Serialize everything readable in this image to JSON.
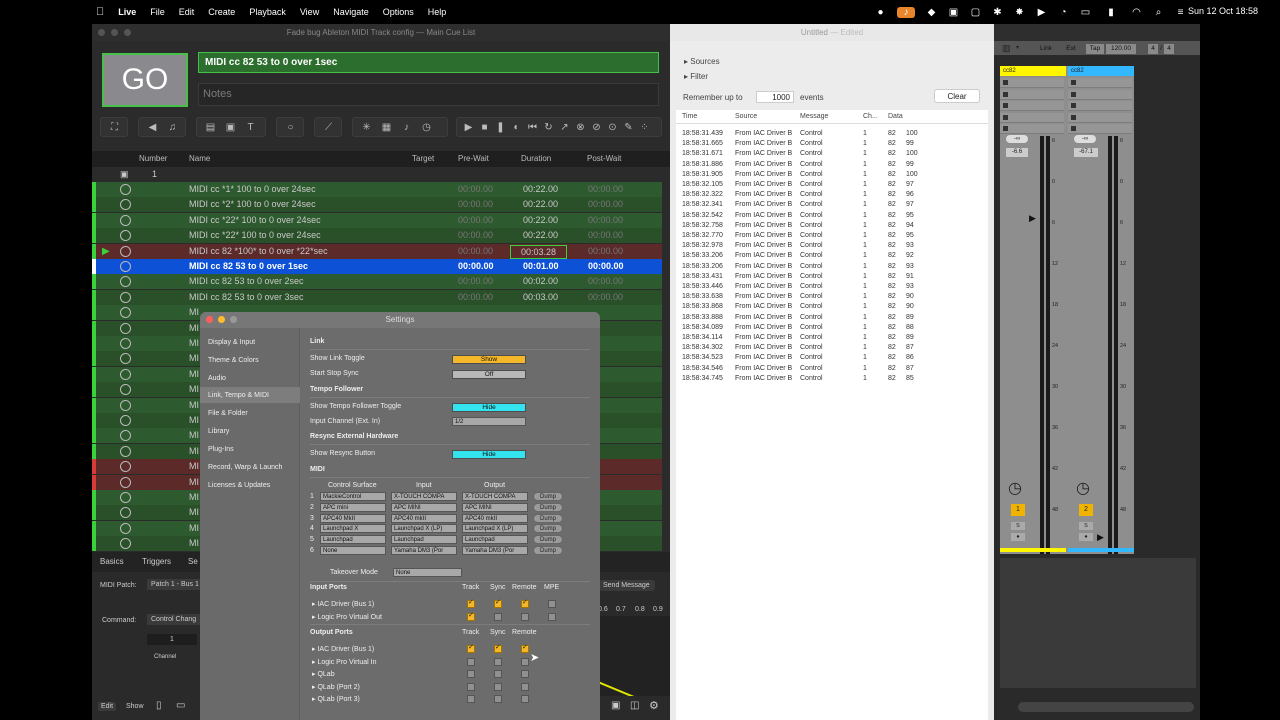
{
  "menubar": {
    "apple": "",
    "app": "Live",
    "items": [
      "File",
      "Edit",
      "Create",
      "Playback",
      "View",
      "Navigate",
      "Options",
      "Help"
    ],
    "datetime": "Sun 12 Oct  18:58"
  },
  "qlab": {
    "title": "Fade bug Ableton MIDI Track config — Main Cue List",
    "go": "GO",
    "cue_name": "MIDI cc 82 53 to 0 over 1sec",
    "notes_placeholder": "Notes",
    "columns": {
      "number": "Number",
      "name": "Name",
      "target": "Target",
      "prewait": "Pre-Wait",
      "duration": "Duration",
      "postwait": "Post-Wait"
    },
    "group_number": "1",
    "rows": [
      {
        "name": "MIDI cc *1* 100 to 0 over 24sec",
        "pre": "00:00.00",
        "dur": "00:22.00",
        "post": "00:00.00"
      },
      {
        "name": "MIDI cc *2* 100 to 0 over 24sec",
        "pre": "00:00.00",
        "dur": "00:22.00",
        "post": "00:00.00"
      },
      {
        "name": "MIDI cc *22* 100 to 0 over 24sec",
        "pre": "00:00.00",
        "dur": "00:22.00",
        "post": "00:00.00"
      },
      {
        "name": "MIDI cc *22* 100 to 0 over 24sec",
        "pre": "00:00.00",
        "dur": "00:22.00",
        "post": "00:00.00"
      },
      {
        "name": "MIDI cc 82 *100* to 0 over *22*sec",
        "pre": "00:00.00",
        "dur": "00:03.28",
        "post": "00:00.00"
      },
      {
        "name": "MIDI cc 82 53 to 0 over 1sec",
        "pre": "00:00.00",
        "dur": "00:01.00",
        "post": "00:00.00"
      },
      {
        "name": "MIDI cc 82 53 to 0 over 2sec",
        "pre": "00:00.00",
        "dur": "00:02.00",
        "post": "00:00.00"
      },
      {
        "name": "MIDI cc 82 53 to 0 over 3sec",
        "pre": "00:00.00",
        "dur": "00:03.00",
        "post": "00:00.00"
      },
      {
        "name": "MI",
        "pre": "",
        "dur": "",
        "post": ""
      },
      {
        "name": "MI",
        "pre": "",
        "dur": "",
        "post": ""
      },
      {
        "name": "MI",
        "pre": "",
        "dur": "",
        "post": ""
      },
      {
        "name": "MI",
        "pre": "",
        "dur": "",
        "post": ""
      },
      {
        "name": "MI",
        "pre": "",
        "dur": "",
        "post": ""
      },
      {
        "name": "MI",
        "pre": "",
        "dur": "",
        "post": ""
      },
      {
        "name": "MI",
        "pre": "",
        "dur": "",
        "post": ""
      },
      {
        "name": "MI",
        "pre": "",
        "dur": "",
        "post": ""
      },
      {
        "name": "MI",
        "pre": "",
        "dur": "",
        "post": ""
      },
      {
        "name": "MI",
        "pre": "",
        "dur": "",
        "post": ""
      },
      {
        "name": "MI",
        "pre": "",
        "dur": "",
        "post": ""
      },
      {
        "name": "MI",
        "pre": "",
        "dur": "",
        "post": ""
      },
      {
        "name": "MI",
        "pre": "",
        "dur": "",
        "post": ""
      },
      {
        "name": "MI",
        "pre": "",
        "dur": "",
        "post": ""
      },
      {
        "name": "MI",
        "pre": "",
        "dur": "",
        "post": ""
      },
      {
        "name": "MI",
        "pre": "",
        "dur": "",
        "post": ""
      }
    ],
    "bottom_tabs": [
      "Basics",
      "Triggers",
      "Se"
    ],
    "inspector": {
      "midi_patch_label": "MIDI Patch:",
      "midi_patch_value": "Patch 1 - Bus 1",
      "command_label": "Command:",
      "command_value": "Control Chang",
      "channel_value": "1",
      "channel_label": "Channel",
      "send_message": "Send Message",
      "scale": [
        "0.6",
        "0.7",
        "0.8",
        "0.9"
      ]
    },
    "footer": {
      "edit": "Edit",
      "show": "Show"
    }
  },
  "settings": {
    "title": "Settings",
    "sidebar": [
      "Display & Input",
      "Theme & Colors",
      "Audio",
      "Link, Tempo & MIDI",
      "File & Folder",
      "Library",
      "Plug-Ins",
      "Record, Warp & Launch",
      "Licenses & Updates"
    ],
    "link_head": "Link",
    "show_link_toggle": "Show Link Toggle",
    "show_link_value": "Show",
    "start_stop_sync": "Start Stop Sync",
    "start_stop_value": "Off",
    "tempo_head": "Tempo Follower",
    "show_tempo": "Show Tempo Follower Toggle",
    "show_tempo_value": "Hide",
    "input_channel": "Input Channel (Ext. In)",
    "input_channel_value": "1/2",
    "resync_head": "Resync External Hardware",
    "show_resync": "Show Resync Button",
    "show_resync_value": "Hide",
    "midi_head": "MIDI",
    "col_cs": "Control Surface",
    "col_in": "Input",
    "col_out": "Output",
    "surfaces": [
      {
        "n": "1",
        "cs": "MackieControl",
        "in": "X-TOUCH COMPA",
        "out": "X-TOUCH COMPA"
      },
      {
        "n": "2",
        "cs": "APC mini",
        "in": "APC MINI",
        "out": "APC MINI"
      },
      {
        "n": "3",
        "cs": "APC40 MkII",
        "in": "APC40 mkII",
        "out": "APC40 mkII"
      },
      {
        "n": "4",
        "cs": "Launchpad X",
        "in": "Launchpad X (LP)",
        "out": "Launchpad X (LP)"
      },
      {
        "n": "5",
        "cs": "Launchpad",
        "in": "Launchpad",
        "out": "Launchpad"
      },
      {
        "n": "6",
        "cs": "None",
        "in": "Yamaha DM3 (Por",
        "out": "Yamaha DM3 (Por"
      }
    ],
    "dump": "Dump",
    "takeover": "Takeover Mode",
    "takeover_value": "None",
    "input_ports": "Input Ports",
    "output_ports": "Output Ports",
    "col_track": "Track",
    "col_sync": "Sync",
    "col_remote": "Remote",
    "col_mpe": "MPE",
    "in_ports": [
      {
        "name": "IAC Driver (Bus 1)",
        "track": true,
        "sync": true,
        "remote": true,
        "mpe": false
      },
      {
        "name": "Logic Pro Virtual Out",
        "track": true,
        "sync": false,
        "remote": false,
        "mpe": false
      }
    ],
    "out_ports": [
      {
        "name": "IAC Driver (Bus 1)",
        "track": true,
        "sync": true,
        "remote": true
      },
      {
        "name": "Logic Pro Virtual In",
        "track": false,
        "sync": false,
        "remote": false
      },
      {
        "name": "QLab",
        "track": false,
        "sync": false,
        "remote": false
      },
      {
        "name": "QLab (Port 2)",
        "track": false,
        "sync": false,
        "remote": false
      },
      {
        "name": "QLab (Port 3)",
        "track": false,
        "sync": false,
        "remote": false
      }
    ]
  },
  "monitor": {
    "title": "Untitled",
    "edited": "— Edited",
    "sources": "Sources",
    "filter": "Filter",
    "remember": "Remember up to",
    "remember_value": "1000",
    "events": "events",
    "clear": "Clear",
    "columns": {
      "time": "Time",
      "source": "Source",
      "message": "Message",
      "ch": "Ch...",
      "data": "Data"
    },
    "rows": [
      {
        "t": "18:58:31.439",
        "v": "100"
      },
      {
        "t": "18:58:31.665",
        "v": "99"
      },
      {
        "t": "18:58:31.671",
        "v": "100"
      },
      {
        "t": "18:58:31.886",
        "v": "99"
      },
      {
        "t": "18:58:31.905",
        "v": "100"
      },
      {
        "t": "18:58:32.105",
        "v": "97"
      },
      {
        "t": "18:58:32.322",
        "v": "96"
      },
      {
        "t": "18:58:32.341",
        "v": "97"
      },
      {
        "t": "18:58:32.542",
        "v": "95"
      },
      {
        "t": "18:58:32.758",
        "v": "94"
      },
      {
        "t": "18:58:32.770",
        "v": "95"
      },
      {
        "t": "18:58:32.978",
        "v": "93"
      },
      {
        "t": "18:58:33.206",
        "v": "92"
      },
      {
        "t": "18:58:33.206",
        "v": "93"
      },
      {
        "t": "18:58:33.431",
        "v": "91"
      },
      {
        "t": "18:58:33.446",
        "v": "93"
      },
      {
        "t": "18:58:33.638",
        "v": "90"
      },
      {
        "t": "18:58:33.868",
        "v": "90"
      },
      {
        "t": "18:58:33.888",
        "v": "89"
      },
      {
        "t": "18:58:34.089",
        "v": "88"
      },
      {
        "t": "18:58:34.114",
        "v": "89"
      },
      {
        "t": "18:58:34.302",
        "v": "87"
      },
      {
        "t": "18:58:34.523",
        "v": "86"
      },
      {
        "t": "18:58:34.546",
        "v": "87"
      },
      {
        "t": "18:58:34.745",
        "v": "85"
      }
    ],
    "source": "From IAC Driver B",
    "message": "Control",
    "channel": "1",
    "cc": "82"
  },
  "live": {
    "link": "Link",
    "ext": "Ext",
    "tap": "Tap",
    "tempo": "120.00",
    "sig_num": "4",
    "sig_den": "4",
    "tracks": [
      {
        "name": "cc82",
        "color": "#fff600",
        "vol": "-6.6",
        "num": "1"
      },
      {
        "name": "cc82",
        "color": "#33b7ff",
        "vol": "-67.1",
        "num": "2"
      }
    ],
    "inf": "-∞",
    "s": "S",
    "scale": [
      "6",
      "0",
      "6",
      "12",
      "18",
      "24",
      "30",
      "36",
      "42",
      "48",
      "54",
      "60"
    ]
  }
}
